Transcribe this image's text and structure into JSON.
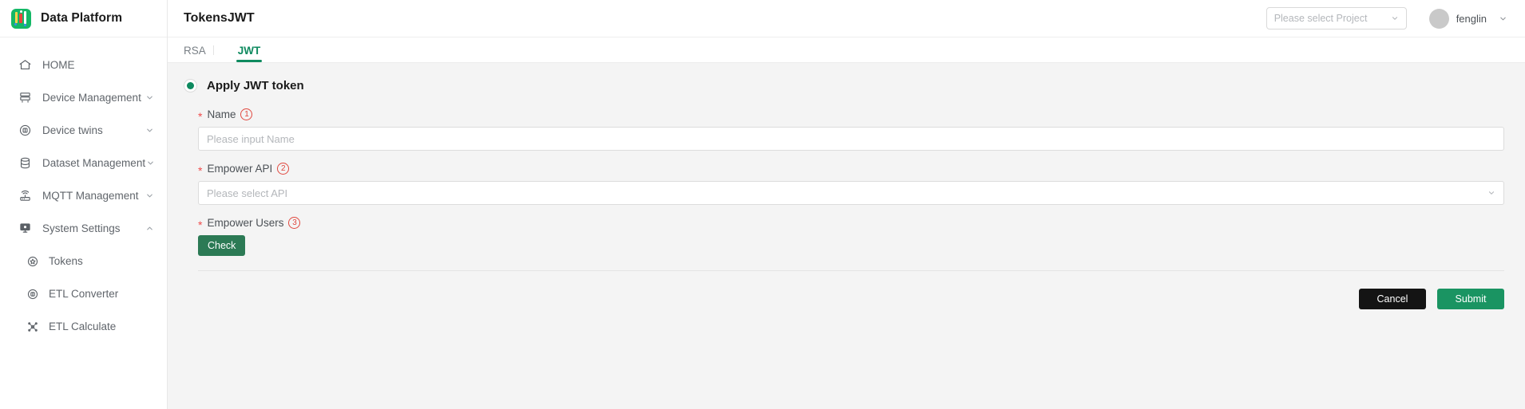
{
  "brand": {
    "name": "Data Platform",
    "logo_icon": "data-platform-logo-icon"
  },
  "sidebar": {
    "items": [
      {
        "label": "HOME",
        "icon": "home-icon",
        "expandable": false,
        "sub": false
      },
      {
        "label": "Device Management",
        "icon": "server-icon",
        "expandable": true,
        "sub": false
      },
      {
        "label": "Device twins",
        "icon": "twins-icon",
        "expandable": true,
        "sub": false
      },
      {
        "label": "Dataset Management",
        "icon": "database-icon",
        "expandable": true,
        "sub": false
      },
      {
        "label": "MQTT Management",
        "icon": "router-icon",
        "expandable": true,
        "sub": false
      },
      {
        "label": "System Settings",
        "icon": "monitor-icon",
        "expandable": true,
        "expanded": true,
        "sub": false
      },
      {
        "label": "Tokens",
        "icon": "token-star-icon",
        "expandable": false,
        "sub": true
      },
      {
        "label": "ETL Converter",
        "icon": "converter-icon",
        "expandable": false,
        "sub": true
      },
      {
        "label": "ETL Calculate",
        "icon": "calculate-icon",
        "expandable": false,
        "sub": true
      }
    ]
  },
  "header": {
    "title": "TokensJWT",
    "project_select": {
      "placeholder": "Please select Project",
      "caret_icon": "chevron-down-icon"
    },
    "user": {
      "name": "fenglin",
      "avatar_icon": "avatar-icon",
      "caret_icon": "chevron-down-icon"
    }
  },
  "tabs": [
    {
      "label": "RSA",
      "active": false
    },
    {
      "label": "JWT",
      "active": true
    }
  ],
  "form": {
    "radio_label": "Apply JWT token",
    "radio_selected": true,
    "fields": [
      {
        "label": "Name",
        "required": true,
        "badge": "1",
        "type": "input",
        "placeholder": "Please input Name",
        "value": ""
      },
      {
        "label": "Empower API",
        "required": true,
        "badge": "2",
        "type": "select",
        "placeholder": "Please select API",
        "value": ""
      },
      {
        "label": "Empower Users",
        "required": true,
        "badge": "3",
        "type": "button",
        "button_label": "Check"
      }
    ]
  },
  "footer": {
    "cancel_label": "Cancel",
    "submit_label": "Submit"
  },
  "colors": {
    "accent_green": "#0e8a5f",
    "submit_green": "#1a9462",
    "check_green": "#2c7a55",
    "cancel_black": "#141414",
    "required_red": "#f04b4b",
    "badge_red": "#e0483f"
  }
}
